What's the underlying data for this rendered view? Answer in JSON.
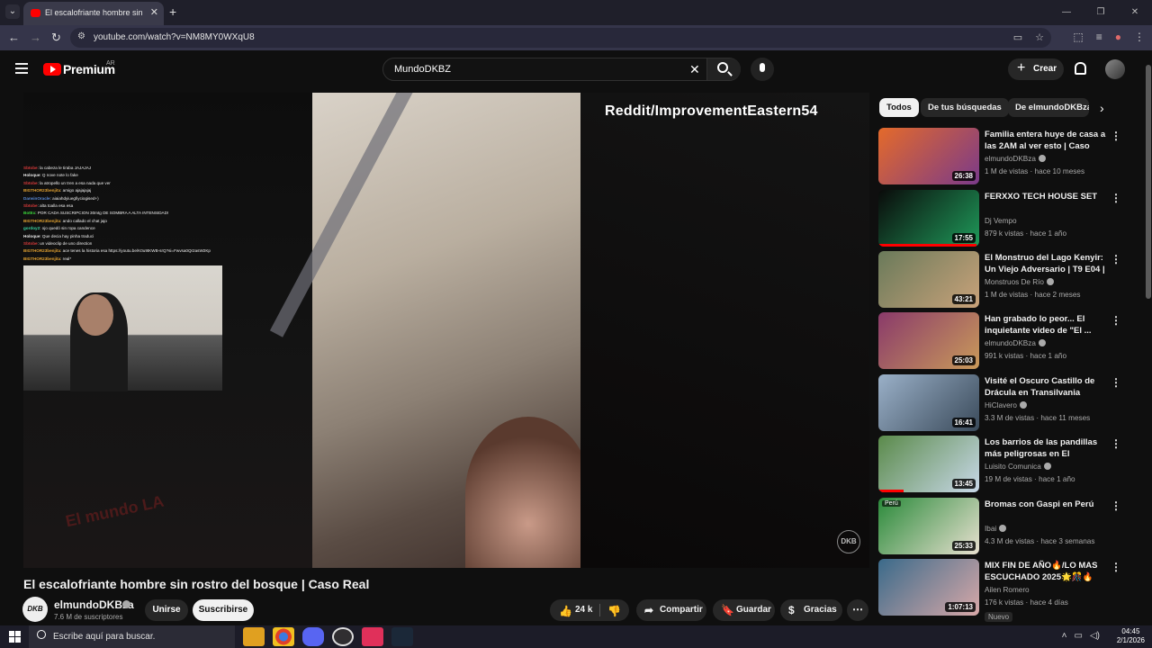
{
  "browser": {
    "tab_title": "El escalofriante hombre sin rostro del bosque | Caso Real - YouTube",
    "url": "youtube.com/watch?v=NM8MY0WXqU8"
  },
  "youtube": {
    "wordmark": "Premium",
    "country": "AR",
    "search_value": "MundoDKBZ",
    "create_label": "Crear"
  },
  "player": {
    "overlay_text": "Reddit/ImprovementEastern54",
    "watermark": "El mundo LA",
    "badge": "DKB",
    "chat": [
      {
        "user": "Sbtobe",
        "msg": ": la cabeza le tiraba JAJAJAJ",
        "color": "#d63a3a"
      },
      {
        "user": "Holoque",
        "msg": ": Q nove note lo fake",
        "color": "#e8e8e8"
      },
      {
        "user": "Sbtobe",
        "msg": ": la atropello un tren a esa nada que ver",
        "color": "#d63a3a"
      },
      {
        "user": "BIGTHOR23benjita",
        "msg": ": amigo ajajajajaj",
        "color": "#e0a030"
      },
      {
        "user": "DarwinOracle",
        "msg": ": aiaiahdyiuegfiyciogised+)",
        "color": "#5a8ad6"
      },
      {
        "user": "Sbtobe",
        "msg": ": alta toalla esa esa",
        "color": "#d63a3a"
      },
      {
        "user": "BotEx",
        "msg": ": POR CADA SUSCRIPCION 30mtg DE SOMBRA A ALTA INTENSIDAD!",
        "color": "#3ad63a"
      },
      {
        "user": "BIGTHOR23benjita",
        "msg": ": ando callado el chat jajo",
        "color": "#e0a030"
      },
      {
        "user": "gordoy2",
        "msg": ": ojo quedó sin ropa candence",
        "color": "#3ad6a0"
      },
      {
        "user": "Holoque",
        "msg": ": Que decia hay pinha traduci",
        "color": "#e8e8e8"
      },
      {
        "user": "Sbtobe",
        "msg": ": un videoclip de uno direction",
        "color": "#d63a3a"
      },
      {
        "user": "BIGTHOR23benjita",
        "msg": ": ace tenes la historia esa https://youtu.be/K0u9tKWB-srQ?si=Fwvsa0Qr2asW2Kp",
        "color": "#e0a030"
      },
      {
        "user": "BIGTHOR23benjita",
        "msg": ": real*",
        "color": "#e0a030"
      }
    ]
  },
  "video": {
    "title": "El escalofriante hombre sin rostro del bosque | Caso Real",
    "channel": "elmundoDKBza",
    "channel_avatar": "DKB",
    "subscribers": "7.6 M de suscriptores",
    "join_label": "Unirse",
    "subscribe_label": "Suscribirse",
    "likes": "24 k",
    "share_label": "Compartir",
    "save_label": "Guardar",
    "thanks_label": "Gracias"
  },
  "chips": [
    "Todos",
    "De tus búsquedas",
    "De elmundoDKBza"
  ],
  "recommendations": [
    {
      "title": "Familia entera huye de casa a las 2AM al ver esto | Caso Real",
      "channel": "elmundoDKBza",
      "verified": true,
      "meta": "1 M de vistas · hace 10 meses",
      "duration": "26:38",
      "progress": 0,
      "thumb_colors": [
        "#e46a2a",
        "#7a3a8a"
      ]
    },
    {
      "title": "FERXXO TECH HOUSE SET",
      "channel": "Dj Vempo",
      "verified": false,
      "meta": "879 k vistas · hace 1 año",
      "duration": "17:55",
      "progress": 0.97,
      "thumb_colors": [
        "#0a0a0a",
        "#1f9a5a"
      ]
    },
    {
      "title": "El Monstruo del Lago Kenyir: Un Viejo Adversario | T9 E04 | ...",
      "channel": "Monstruos De Río",
      "verified": true,
      "meta": "1 M de vistas · hace 2 meses",
      "duration": "43:21",
      "progress": 0,
      "thumb_colors": [
        "#6a7a5a",
        "#c9a27a"
      ]
    },
    {
      "title": "Han grabado lo peor... El inquietante video de \"El ...",
      "channel": "elmundoDKBza",
      "verified": true,
      "meta": "991 k vistas · hace 1 año",
      "duration": "25:03",
      "progress": 0,
      "thumb_colors": [
        "#8a3a6a",
        "#c99a5a"
      ]
    },
    {
      "title": "Visité el Oscuro Castillo de Drácula en Transilvania",
      "channel": "HiClavero",
      "verified": true,
      "meta": "3.3 M de vistas · hace 11 meses",
      "duration": "16:41",
      "progress": 0,
      "thumb_colors": [
        "#9ab0c8",
        "#3a4a5a"
      ]
    },
    {
      "title": "Los barrios de las pandillas más peligrosas en El Salvador | ...",
      "channel": "Luisito Comunica",
      "verified": true,
      "meta": "19 M de vistas · hace 1 año",
      "duration": "13:45",
      "progress": 0.25,
      "thumb_colors": [
        "#5a8a4a",
        "#c8d8e8"
      ]
    },
    {
      "title": "Bromas con Gaspi en Perú",
      "channel": "Ibai",
      "verified": true,
      "meta": "4.3 M de vistas · hace 3 semanas",
      "duration": "25:33",
      "progress": 0,
      "thumb_colors": [
        "#2a8a3a",
        "#e8e0d0"
      ],
      "tag": "Perú"
    },
    {
      "title": "MIX FIN DE AÑO🔥/LO MAS ESCUCHADO 2025🌟🎊🔥 (tu...",
      "channel": "Ailen Romero",
      "verified": false,
      "meta": "176 k vistas · hace 4 días",
      "duration": "1:07:13",
      "progress": 0,
      "thumb_colors": [
        "#3a6a8a",
        "#d8a8a8"
      ],
      "badge": "Nuevo"
    }
  ],
  "taskbar": {
    "search_placeholder": "Escribe aquí para buscar.",
    "time": "04:45",
    "date": "2/1/2026"
  }
}
